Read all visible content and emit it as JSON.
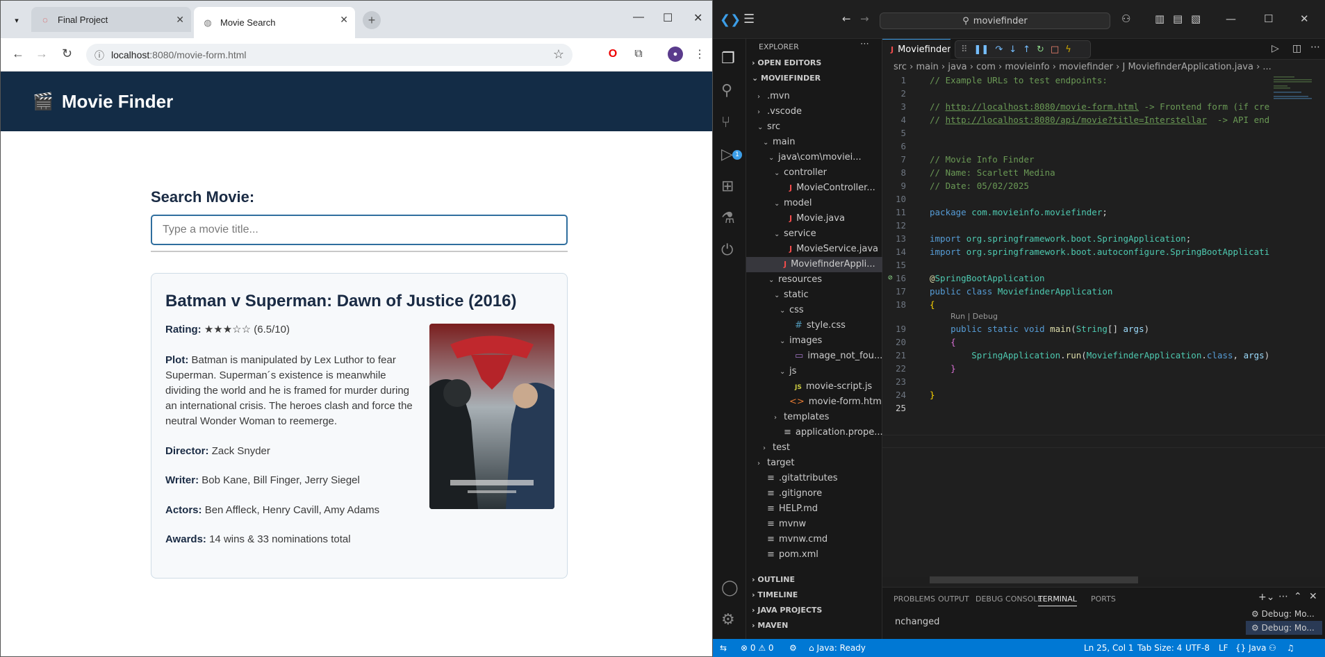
{
  "browser": {
    "tabs": [
      {
        "title": "Final Project",
        "active": false
      },
      {
        "title": "Movie Search",
        "active": true
      }
    ],
    "url_host": "localhost",
    "url_rest": ":8080/movie-form.html"
  },
  "site": {
    "header_title": "Movie Finder",
    "search_label": "Search Movie:",
    "search_placeholder": "Type a movie title...",
    "movie": {
      "title": "Batman v Superman: Dawn of Justice (2016)",
      "rating_label": "Rating:",
      "rating_stars": "★★★☆☆",
      "rating_value": "(6.5/10)",
      "plot_label": "Plot:",
      "plot": "Batman is manipulated by Lex Luthor to fear Superman. Superman´s existence is meanwhile dividing the world and he is framed for murder during an international crisis. The heroes clash and force the neutral Wonder Woman to reemerge.",
      "director_label": "Director:",
      "director": "Zack Snyder",
      "writer_label": "Writer:",
      "writer": "Bob Kane, Bill Finger, Jerry Siegel",
      "actors_label": "Actors:",
      "actors": "Ben Affleck, Henry Cavill, Amy Adams",
      "awards_label": "Awards:",
      "awards": "14 wins & 33 nominations total"
    }
  },
  "vscode": {
    "search": "moviefinder",
    "explorer_label": "EXPLORER",
    "sections": {
      "open_editors": "OPEN EDITORS",
      "project": "MOVIEFINDER",
      "outline": "OUTLINE",
      "timeline": "TIMELINE",
      "java_projects": "JAVA PROJECTS",
      "maven": "MAVEN"
    },
    "tree": [
      {
        "label": ".mvn",
        "depth": 1,
        "chev": "›",
        "icon": ""
      },
      {
        "label": ".vscode",
        "depth": 1,
        "chev": "›",
        "icon": ""
      },
      {
        "label": "src",
        "depth": 1,
        "chev": "⌄",
        "icon": ""
      },
      {
        "label": "main",
        "depth": 2,
        "chev": "⌄",
        "icon": ""
      },
      {
        "label": "java\\com\\moviei...",
        "depth": 3,
        "chev": "⌄",
        "icon": ""
      },
      {
        "label": "controller",
        "depth": 4,
        "chev": "⌄",
        "icon": ""
      },
      {
        "label": "MovieController...",
        "depth": 5,
        "chev": "",
        "icon": "java"
      },
      {
        "label": "model",
        "depth": 4,
        "chev": "⌄",
        "icon": ""
      },
      {
        "label": "Movie.java",
        "depth": 5,
        "chev": "",
        "icon": "java"
      },
      {
        "label": "service",
        "depth": 4,
        "chev": "⌄",
        "icon": ""
      },
      {
        "label": "MovieService.java",
        "depth": 5,
        "chev": "",
        "icon": "java"
      },
      {
        "label": "MoviefinderAppli...",
        "depth": 4,
        "chev": "",
        "icon": "java",
        "selected": true
      },
      {
        "label": "resources",
        "depth": 3,
        "chev": "⌄",
        "icon": ""
      },
      {
        "label": "static",
        "depth": 4,
        "chev": "⌄",
        "icon": ""
      },
      {
        "label": "css",
        "depth": 5,
        "chev": "⌄",
        "icon": ""
      },
      {
        "label": "style.css",
        "depth": 6,
        "chev": "",
        "icon": "css"
      },
      {
        "label": "images",
        "depth": 5,
        "chev": "⌄",
        "icon": ""
      },
      {
        "label": "image_not_fou...",
        "depth": 6,
        "chev": "",
        "icon": "img"
      },
      {
        "label": "js",
        "depth": 5,
        "chev": "⌄",
        "icon": ""
      },
      {
        "label": "movie-script.js",
        "depth": 6,
        "chev": "",
        "icon": "js"
      },
      {
        "label": "movie-form.html",
        "depth": 5,
        "chev": "",
        "icon": "html"
      },
      {
        "label": "templates",
        "depth": 4,
        "chev": "›",
        "icon": ""
      },
      {
        "label": "application.prope...",
        "depth": 4,
        "chev": "",
        "icon": "gen"
      },
      {
        "label": "test",
        "depth": 2,
        "chev": "›",
        "icon": ""
      },
      {
        "label": "target",
        "depth": 1,
        "chev": "›",
        "icon": ""
      },
      {
        "label": ".gitattributes",
        "depth": 1,
        "chev": "",
        "icon": "gen"
      },
      {
        "label": ".gitignore",
        "depth": 1,
        "chev": "",
        "icon": "gen"
      },
      {
        "label": "HELP.md",
        "depth": 1,
        "chev": "",
        "icon": "gen"
      },
      {
        "label": "mvnw",
        "depth": 1,
        "chev": "",
        "icon": "gen"
      },
      {
        "label": "mvnw.cmd",
        "depth": 1,
        "chev": "",
        "icon": "gen"
      },
      {
        "label": "pom.xml",
        "depth": 1,
        "chev": "",
        "icon": "gen"
      }
    ],
    "editor_tab": "MoviefinderA",
    "breadcrumb": "src › main › java › com › movieinfo › moviefinder › J MoviefinderApplication.java › ...",
    "code_lens": "Run | Debug",
    "panel_tabs": [
      "PROBLEMS",
      "OUTPUT",
      "DEBUG CONSOLE",
      "TERMINAL",
      "PORTS"
    ],
    "terminal_text": "nchanged",
    "debug_sessions": [
      "Debug: Mo...",
      "Debug: Mo..."
    ],
    "status": {
      "problems": "⊗ 0 ⚠ 0",
      "java": "Java: Ready",
      "position": "Ln 25, Col 1",
      "tab_size": "Tab Size: 4",
      "encoding": "UTF-8",
      "eol": "LF",
      "language": "{} Java"
    }
  }
}
